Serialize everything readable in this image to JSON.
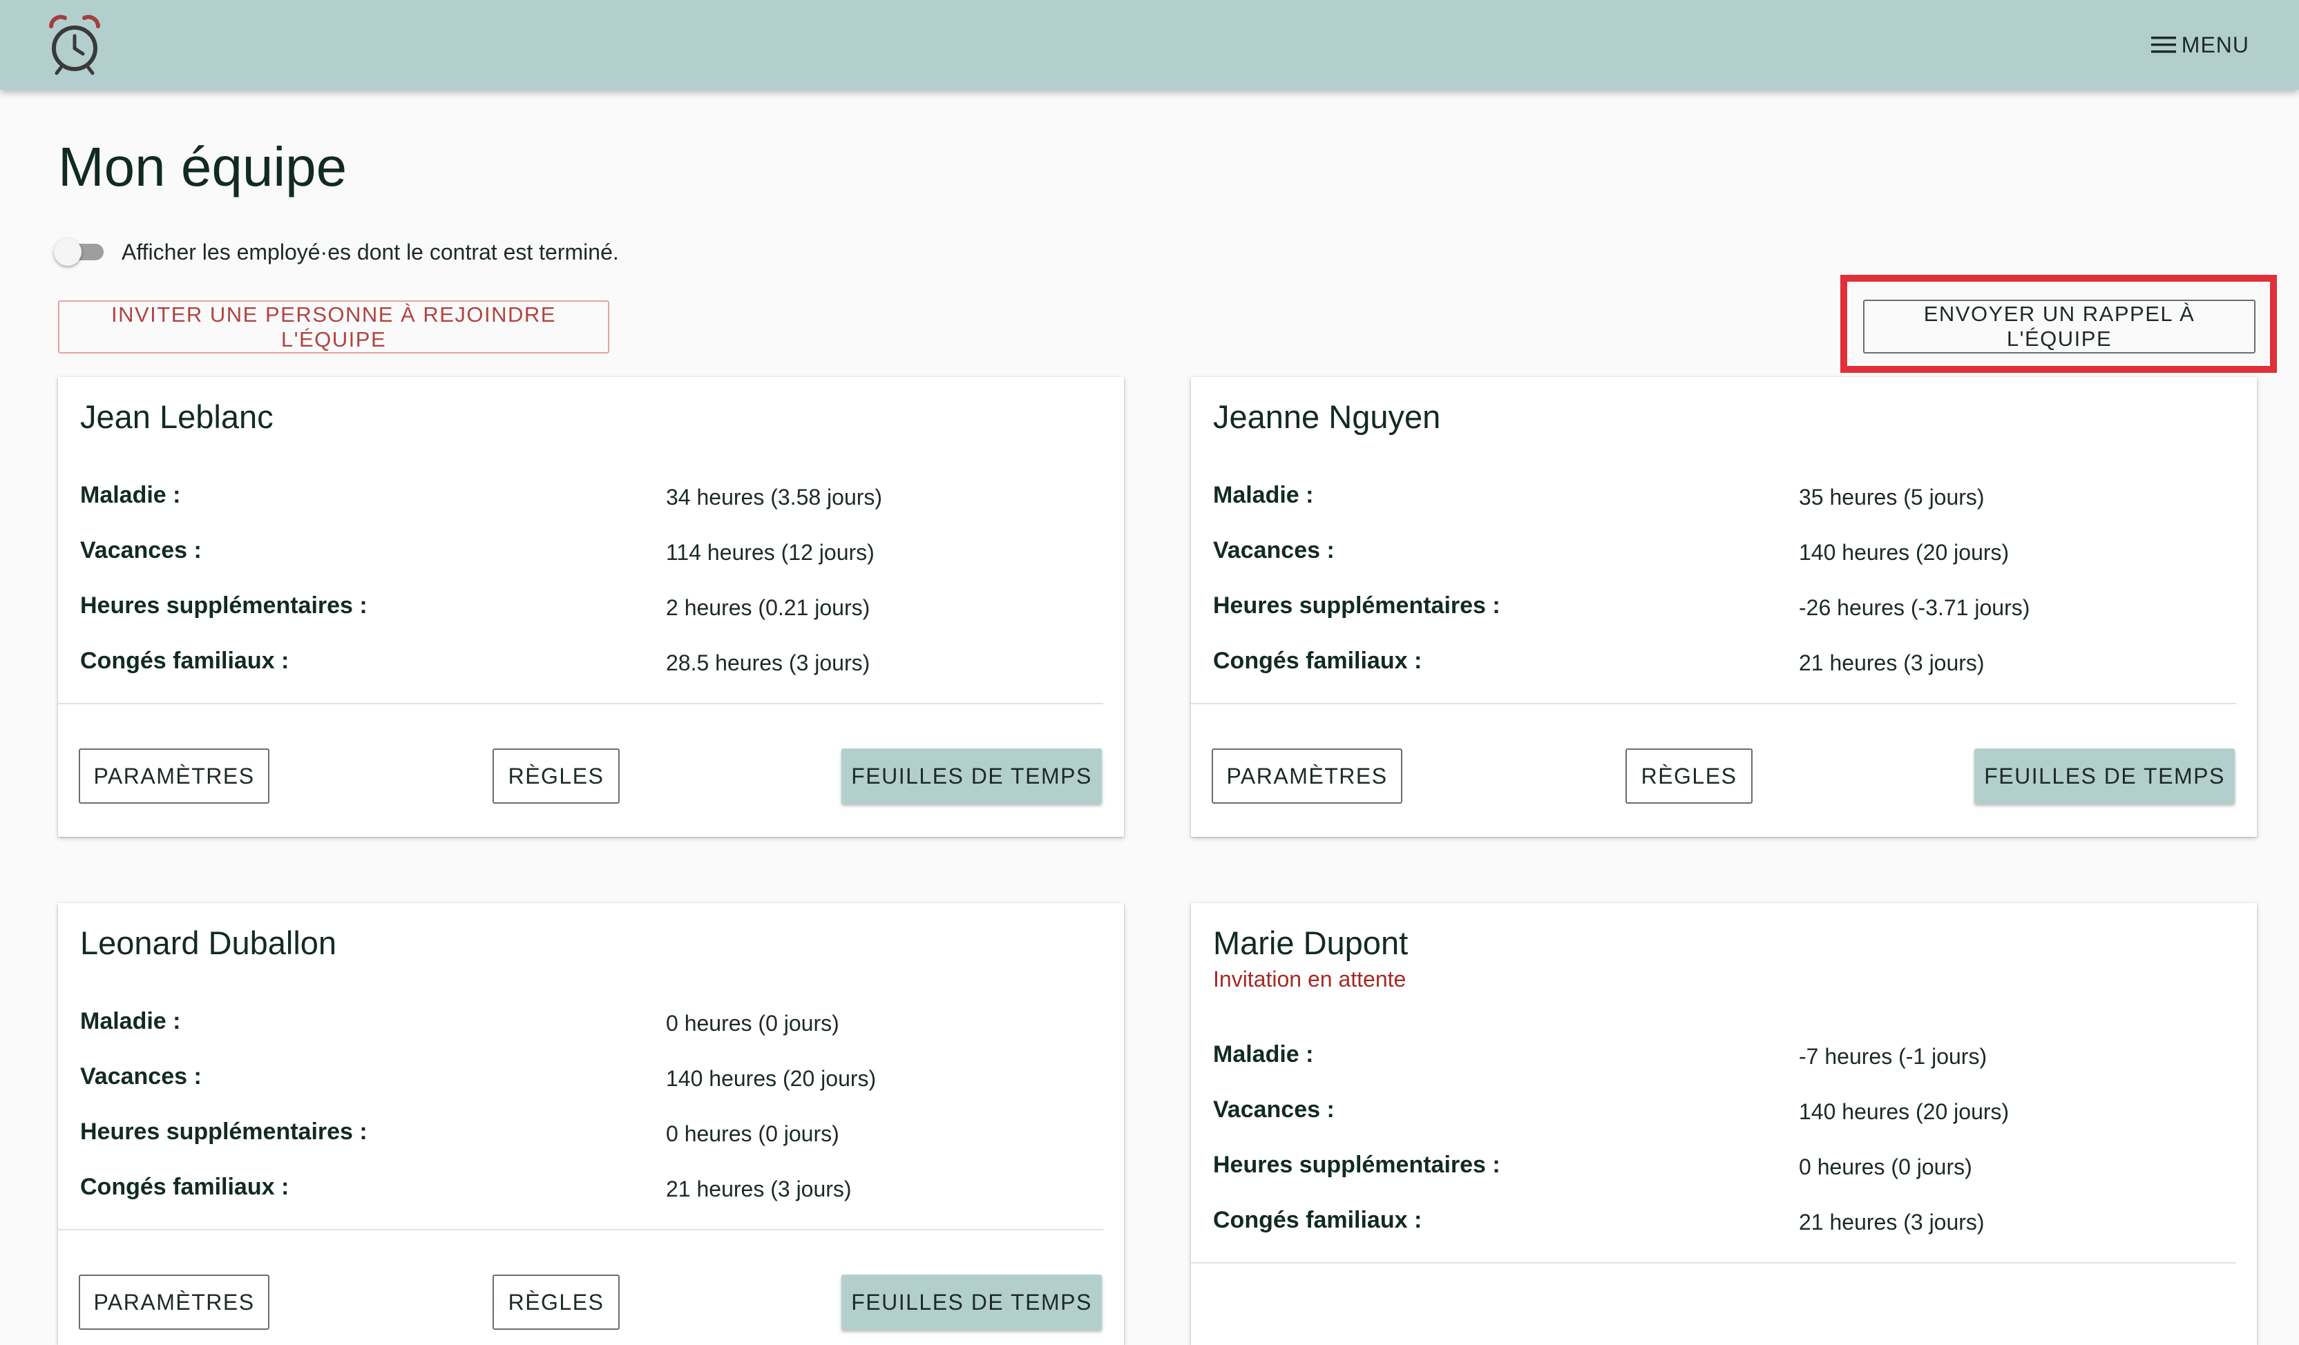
{
  "header": {
    "logo_icon": "alarm-clock-icon",
    "menu_icon": "hamburger-icon",
    "menu_label": "MENU"
  },
  "page": {
    "title": "Mon équipe",
    "toggle_label": "Afficher les employé·es dont le contrat est terminé.",
    "toggle_checked": false,
    "invite_button": "INVITER UNE PERSONNE À REJOINDRE L'ÉQUIPE",
    "reminder_button": "ENVOYER UN RAPPEL À L'ÉQUIPE"
  },
  "card_labels": {
    "sick": "Maladie :",
    "vacation": "Vacances :",
    "overtime": "Heures supplémentaires :",
    "family": "Congés familiaux :",
    "settings_button": "PARAMÈTRES",
    "rules_button": "RÈGLES",
    "timesheets_button": "FEUILLES DE TEMPS"
  },
  "members": [
    {
      "name": "Jean Leblanc",
      "status": "",
      "sick": "34 heures (3.58 jours)",
      "vacation": "114 heures (12 jours)",
      "overtime": "2 heures (0.21 jours)",
      "family": "28.5 heures (3 jours)"
    },
    {
      "name": "Jeanne Nguyen",
      "status": "",
      "sick": "35 heures (5 jours)",
      "vacation": "140 heures (20 jours)",
      "overtime": "-26 heures (-3.71 jours)",
      "family": "21 heures (3 jours)"
    },
    {
      "name": "Leonard Duballon",
      "status": "",
      "sick": "0 heures (0 jours)",
      "vacation": "140 heures (20 jours)",
      "overtime": "0 heures (0 jours)",
      "family": "21 heures (3 jours)"
    },
    {
      "name": "Marie Dupont",
      "status": "Invitation en attente",
      "sick": "-7 heures (-1 jours)",
      "vacation": "140 heures (20 jours)",
      "overtime": "0 heures (0 jours)",
      "family": "21 heures (3 jours)"
    }
  ],
  "colors": {
    "header_bg": "#b2cfcd",
    "accent_red": "#b2433f",
    "highlight_red": "#e0303a",
    "pending_status": "#a52a24"
  }
}
